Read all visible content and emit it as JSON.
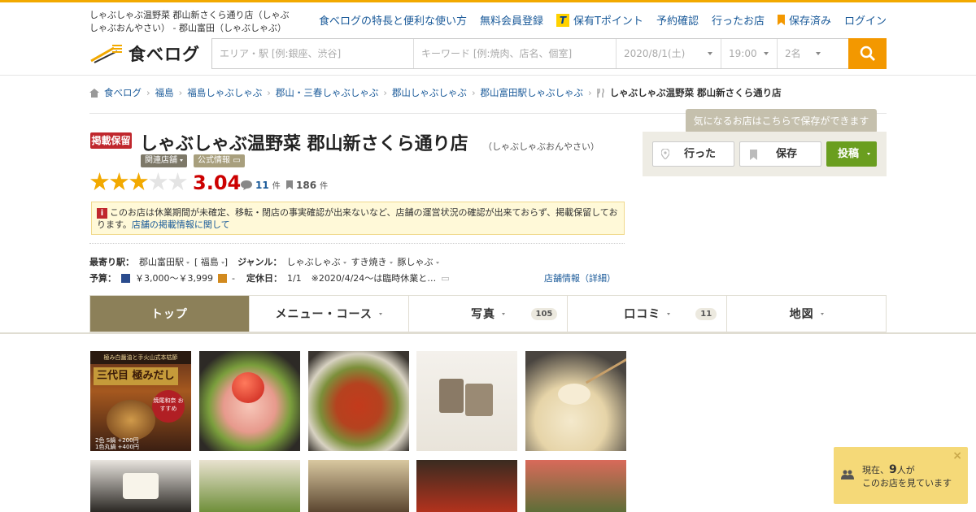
{
  "header": {
    "site_title": "しゃぶしゃぶ温野菜 郡山新さくら通り店（しゃぶしゃぶおんやさい） - 郡山富田（しゃぶしゃぶ）",
    "nav": [
      "食べログの特長と便利な使い方",
      "無料会員登録",
      "保有Tポイント",
      "予約確認",
      "行ったお店",
      "保存済み",
      "ログイン"
    ],
    "tpoint_badge": "T",
    "logo_text": "食べログ"
  },
  "search": {
    "area_placeholder": "エリア・駅 [例:銀座、渋谷]",
    "keyword_placeholder": "キーワード [例:焼肉、店名、個室]",
    "date": "2020/8/1(土)",
    "time": "19:00",
    "people": "2名"
  },
  "breadcrumb": [
    "食べログ",
    "福島",
    "福島しゃぶしゃぶ",
    "郡山・三春しゃぶしゃぶ",
    "郡山しゃぶしゃぶ",
    "郡山富田駅しゃぶしゃぶ",
    "しゃぶしゃぶ温野菜 郡山新さくら通り店"
  ],
  "shop": {
    "status_badge": "掲載保留",
    "name": "しゃぶしゃぶ温野菜 郡山新さくら通り店",
    "reading": "（しゃぶしゃぶおんやさい）",
    "related_tag": "関連店舗",
    "official_tag": "公式情報",
    "rating": "3.04",
    "rating_value": 3.04,
    "review_count": "11",
    "save_count": "186",
    "count_unit": "件",
    "notice_text": "このお店は休業期間が未確定、移転・閉店の事実確認が出来ないなど、店舗の運営状況の確認が出来ておらず、掲載保留しております。",
    "notice_link": "店舗の掲載情報に関して",
    "notice_icon": "i"
  },
  "info": {
    "station_label": "最寄り駅：",
    "station": "郡山富田駅",
    "station_area": "[ 福島",
    "station_area_close": "]",
    "genre_label": "ジャンル：",
    "genres": [
      "しゃぶしゃぶ",
      "すき焼き",
      "豚しゃぶ"
    ],
    "budget_label": "予算：",
    "budget_dinner": "￥3,000～￥3,999",
    "budget_lunch": "-",
    "holiday_label": "定休日：",
    "holiday": "1/1",
    "holiday_note": "※2020/4/24～は臨時休業と…",
    "shop_info_link": "店舗情報（詳細）"
  },
  "actions": {
    "tooltip": "気になるお店はこちらで保存ができます",
    "went": "行った",
    "save": "保存",
    "post": "投稿"
  },
  "tabs": [
    {
      "label": "トップ",
      "count": ""
    },
    {
      "label": "メニュー・コース",
      "count": ""
    },
    {
      "label": "写真",
      "count": "105"
    },
    {
      "label": "口コミ",
      "count": "11"
    },
    {
      "label": "地図",
      "count": ""
    }
  ],
  "photo_text": {
    "title_small": "極み白醤油と手火山式本枯節",
    "brand": "三代目 極みだし",
    "line1": "2色 S鍋 +200円",
    "line2": "1色丸鍋 +400円",
    "stamp": "焼尾和奈 おすすめ"
  },
  "now_viewing": {
    "prefix": "現在、",
    "count": "9",
    "suffix": "人が",
    "line2": "このお店を見ています",
    "close": "×"
  },
  "colors": {
    "accent": "#f39800",
    "link": "#1a5a99",
    "rating": "#cc0000",
    "tab_active": "#8c8059",
    "post_button": "#6a9e1f"
  }
}
